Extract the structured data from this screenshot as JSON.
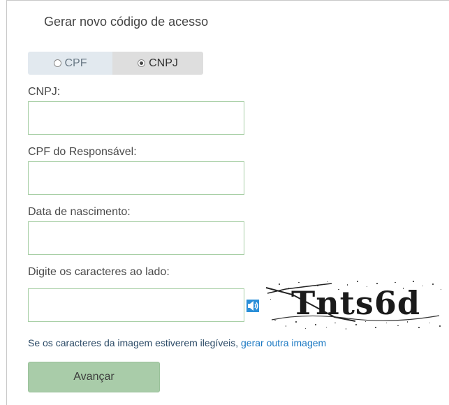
{
  "form": {
    "title": "Gerar novo código de acesso",
    "toggle": {
      "options": [
        {
          "label": "CPF",
          "selected": false
        },
        {
          "label": "CNPJ",
          "selected": true
        }
      ]
    },
    "fields": [
      {
        "label": "CNPJ:",
        "value": ""
      },
      {
        "label": "CPF do Responsável:",
        "value": ""
      },
      {
        "label": "Data de nascimento:",
        "value": ""
      },
      {
        "label": "Digite os caracteres ao lado:",
        "value": ""
      }
    ],
    "captcha": {
      "text": "Tnts6d",
      "help_prefix": "Se os caracteres da imagem estiverem ilegíveis,",
      "help_link": "gerar outra imagem",
      "audio_icon": "speaker-icon"
    },
    "submit_label": "Avançar"
  },
  "colors": {
    "input_border": "#a8cfa6",
    "button_bg": "#a9cca9",
    "link": "#1a78c2",
    "toggle_unselected": "#e2e9ef",
    "toggle_selected": "#dedede"
  }
}
